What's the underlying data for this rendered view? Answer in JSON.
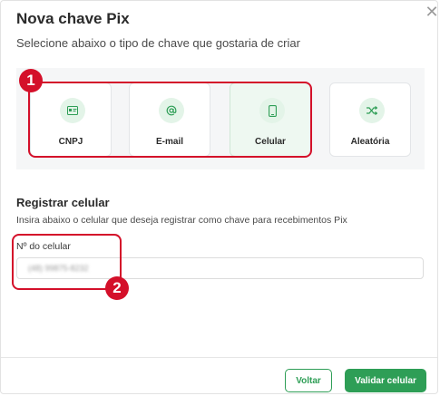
{
  "modal": {
    "title": "Nova chave Pix",
    "close_label": "✕",
    "subtitle": "Selecione abaixo o tipo de chave que gostaria de criar"
  },
  "options": [
    {
      "label": "CNPJ",
      "icon": "id-card-icon",
      "selected": false
    },
    {
      "label": "E-mail",
      "icon": "at-sign-icon",
      "selected": false
    },
    {
      "label": "Celular",
      "icon": "smartphone-icon",
      "selected": true
    },
    {
      "label": "Aleatória",
      "icon": "shuffle-icon",
      "selected": false
    }
  ],
  "annotations": {
    "badge1": "1",
    "badge2": "2"
  },
  "form": {
    "section_title": "Registrar celular",
    "section_desc": "Insira abaixo o celular que deseja registrar como chave para recebimentos Pix",
    "field_label": "Nº do celular",
    "phone_value": "(48) 99875-8232"
  },
  "footer": {
    "back_label": "Voltar",
    "confirm_label": "Validar celular"
  },
  "colors": {
    "accent_green": "#2e9e56",
    "highlight_red": "#d4102a"
  }
}
